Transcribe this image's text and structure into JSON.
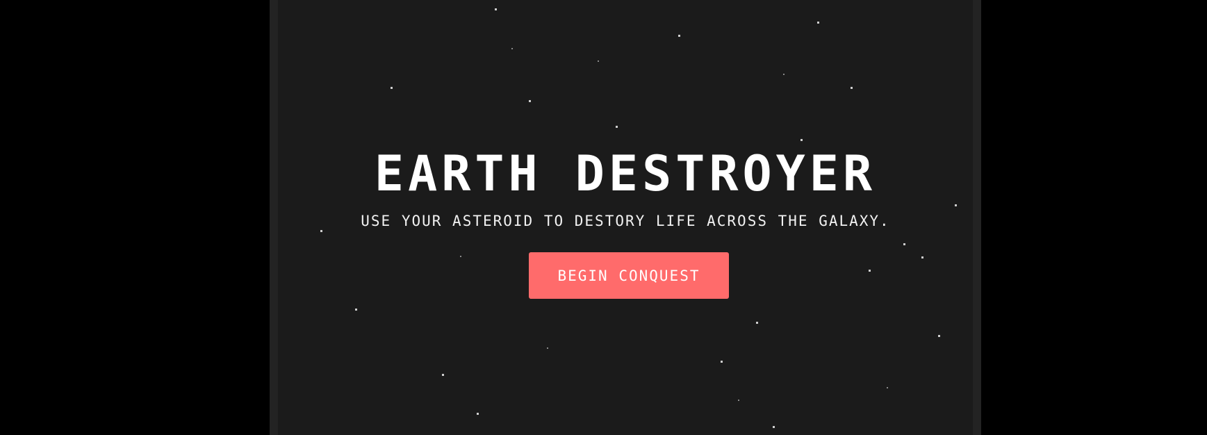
{
  "game": {
    "title": "EARTH DESTROYER",
    "subtitle": "USE YOUR ASTEROID TO DESTORY LIFE ACROSS THE GALAXY.",
    "start_button_label": "BEGIN CONQUEST"
  },
  "colors": {
    "background": "#000000",
    "frame": "#1b1b1b",
    "button": "#ff6b6b",
    "text": "#ffffff"
  }
}
